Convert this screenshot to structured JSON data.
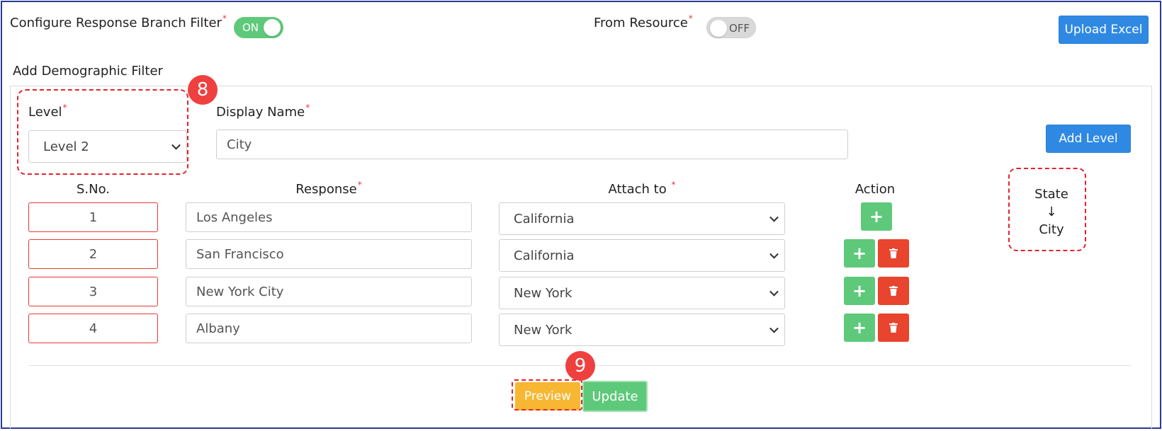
{
  "header": {
    "branch_filter_label": "Configure Response Branch Filter",
    "branch_filter_required": "*",
    "branch_filter_toggle": "ON",
    "from_resource_label": "From Resource",
    "from_resource_required": "*",
    "from_resource_toggle": "OFF",
    "upload_excel_label": "Upload Excel"
  },
  "section": {
    "title": "Add Demographic Filter"
  },
  "form": {
    "level_label": "Level",
    "level_required": "*",
    "level_value": "Level 2",
    "display_name_label": "Display Name",
    "display_name_required": "*",
    "display_name_value": "City",
    "add_level_label": "Add Level"
  },
  "table": {
    "headers": {
      "sno": "S.No.",
      "response": "Response",
      "response_required": "*",
      "attach_to": "Attach to",
      "attach_to_required": "*",
      "action": "Action"
    },
    "rows": [
      {
        "sno": "1",
        "response": "Los Angeles",
        "attach_to": "California"
      },
      {
        "sno": "2",
        "response": "San Francisco",
        "attach_to": "California"
      },
      {
        "sno": "3",
        "response": "New York City",
        "attach_to": "New York"
      },
      {
        "sno": "4",
        "response": "Albany",
        "attach_to": "New York"
      }
    ]
  },
  "hierarchy": {
    "parent": "State",
    "arrow": "↓",
    "child": "City"
  },
  "annotations": {
    "badge_level": "8",
    "badge_preview": "9"
  },
  "footer": {
    "preview_label": "Preview",
    "update_label": "Update"
  },
  "colors": {
    "accent_blue": "#2f89e3",
    "success_green": "#5ec97a",
    "danger_red": "#e8442e",
    "warning_yellow": "#f7b733",
    "annotation_red": "#e0242f"
  }
}
